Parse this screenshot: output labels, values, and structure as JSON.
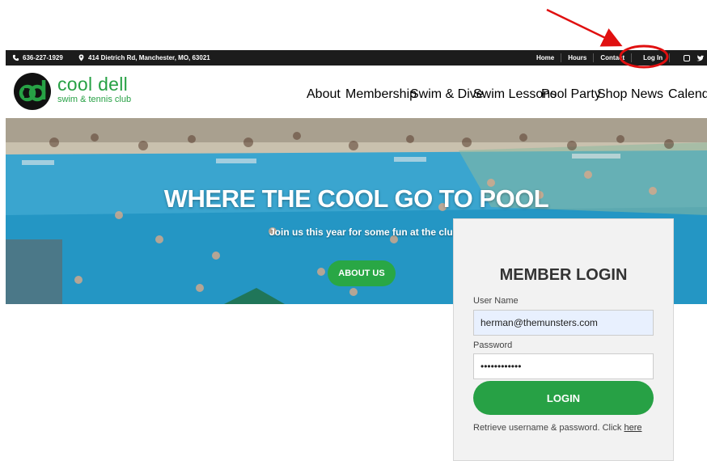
{
  "topbar": {
    "phone": "636-227-1929",
    "address": "414 Dietrich Rd, Manchester, MO, 63021",
    "links": [
      "Home",
      "Hours",
      "Contact",
      "Log In"
    ]
  },
  "brand": {
    "logo_letters": "cd",
    "name": "cool dell",
    "tagline": "swim & tennis club",
    "accent_color": "#27a145"
  },
  "nav": {
    "items": [
      "About",
      "Membership",
      "Swim & Dive",
      "Swim Lessons",
      "Pool Party",
      "Shop",
      "News",
      "Calendar"
    ]
  },
  "hero": {
    "title": "WHERE THE COOL GO TO POOL",
    "subtitle": "Join us this year for some fun at the club.",
    "button": "ABOUT US"
  },
  "login": {
    "title": "MEMBER LOGIN",
    "username_label": "User Name",
    "username_value": "herman@themunsters.com",
    "password_label": "Password",
    "password_value": "••••••••••••",
    "button": "LOGIN",
    "footer_text": "Retrieve username & password. Click ",
    "footer_link": "here"
  },
  "annotation": {
    "color": "#e01010",
    "target": "Log In"
  }
}
